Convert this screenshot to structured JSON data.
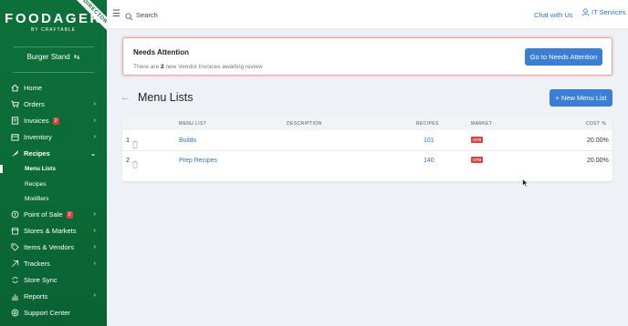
{
  "app": {
    "logo_main": "FOODAGER",
    "logo_sub": "BY CRAFTABLE",
    "ribbon": "DIRECTOR",
    "store_name": "Burger Stand",
    "store_switch_icon": "swap-icon"
  },
  "sidebar": {
    "items": [
      {
        "label": "Home",
        "icon": "home-icon"
      },
      {
        "label": "Orders",
        "icon": "cart-icon",
        "chevron": "chevron-right"
      },
      {
        "label": "Invoices",
        "icon": "invoice-icon",
        "badge": "2",
        "chevron": "chevron-right"
      },
      {
        "label": "Inventory",
        "icon": "inventory-icon",
        "chevron": "chevron-right"
      },
      {
        "label": "Recipes",
        "icon": "recipe-icon",
        "chevron": "chevron-down",
        "active": true
      },
      {
        "label": "Point of Sale",
        "icon": "pos-icon",
        "badge": "2",
        "chevron": "chevron-right"
      },
      {
        "label": "Stores & Markets",
        "icon": "store-icon",
        "chevron": "chevron-right"
      },
      {
        "label": "Items & Vendors",
        "icon": "tag-icon",
        "chevron": "chevron-right"
      },
      {
        "label": "Trackers",
        "icon": "tracker-icon",
        "chevron": "chevron-right"
      },
      {
        "label": "Store Sync",
        "icon": "sync-icon"
      },
      {
        "label": "Reports",
        "icon": "reports-icon",
        "chevron": "chevron-right"
      },
      {
        "label": "Support Center",
        "icon": "support-icon"
      }
    ],
    "recipe_subitems": [
      {
        "label": "Menu Lists",
        "active": true
      },
      {
        "label": "Recipes"
      },
      {
        "label": "Modifiers"
      }
    ]
  },
  "topbar": {
    "search_placeholder": "Search",
    "chat_label": "Chat with Us",
    "user_label": "IT Services"
  },
  "alert": {
    "title": "Needs Attention",
    "text_prefix": "There are",
    "count": "2",
    "text_suffix": "new Vendor Invoices awaiting review",
    "button_label": "Go to Needs Attention"
  },
  "page": {
    "title": "Menu Lists",
    "new_button_label": "+ New Menu List"
  },
  "table": {
    "headers": {
      "menu_list": "MENU LIST",
      "description": "DESCRIPTION",
      "recipes": "RECIPES",
      "market": "MARKET",
      "cost": "COST %"
    },
    "rows": [
      {
        "index": "1",
        "name": "Builds",
        "description": "",
        "recipes": "101",
        "market": "GFB",
        "cost": "20.00%"
      },
      {
        "index": "2",
        "name": "Prep Recipes",
        "description": "",
        "recipes": "140",
        "market": "GFB",
        "cost": "20.00%"
      }
    ]
  },
  "colors": {
    "sidebar_green": "#0b6b37",
    "primary_blue": "#3a7fd5",
    "link_blue": "#2f73c9",
    "badge_red": "#d64545"
  }
}
